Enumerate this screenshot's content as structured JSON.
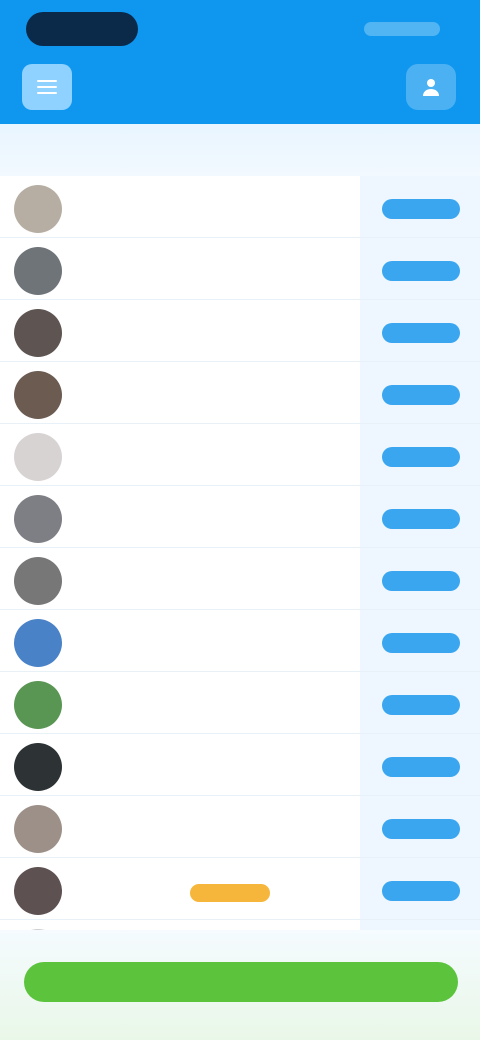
{
  "header": {
    "title": "",
    "left_icon": "menu-icon",
    "right_icon": "profile-icon",
    "accent": "#0f97ef"
  },
  "columns": {
    "left": "",
    "middle": "",
    "right": ""
  },
  "rows": [
    {
      "name": "",
      "avatar_color": "#b7aea3",
      "action_label": ""
    },
    {
      "name": "",
      "avatar_color": "#6f7479",
      "action_label": ""
    },
    {
      "name": "",
      "avatar_color": "#5e5553",
      "action_label": ""
    },
    {
      "name": "",
      "avatar_color": "#6b5b51",
      "action_label": ""
    },
    {
      "name": "",
      "avatar_color": "#d8d3d3",
      "action_label": ""
    },
    {
      "name": "",
      "avatar_color": "#7e7f84",
      "action_label": ""
    },
    {
      "name": "",
      "avatar_color": "#777777",
      "action_label": ""
    },
    {
      "name": "",
      "avatar_color": "#4a82c7",
      "action_label": ""
    },
    {
      "name": "",
      "avatar_color": "#5a9653",
      "action_label": ""
    },
    {
      "name": "",
      "avatar_color": "#2d3335",
      "action_label": ""
    },
    {
      "name": "",
      "avatar_color": "#9d9088",
      "action_label": ""
    },
    {
      "name": "",
      "avatar_color": "#5e5152",
      "action_label": "",
      "badge": ""
    },
    {
      "name": "",
      "avatar_color": "#cfcfcf",
      "action_label": ""
    }
  ],
  "footer": {
    "button_label": "",
    "button_color": "#5cc33d"
  }
}
